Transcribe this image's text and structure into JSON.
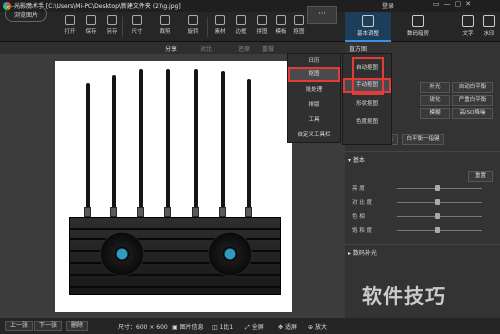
{
  "app": {
    "title": "光影魔术手  [C:\\Users\\Mi-PC\\Desktop\\新建文件夹 (2)\\g.jpg]",
    "user_login": "登录",
    "window_controls": [
      "▭",
      "—",
      "▢",
      "✕"
    ]
  },
  "toolbar": {
    "browse": "浏览图片",
    "tools": [
      {
        "label": "打开",
        "icon": "folder-icon"
      },
      {
        "label": "保存",
        "icon": "save-icon"
      },
      {
        "label": "另存",
        "icon": "save-as-icon"
      },
      {
        "label": "尺寸",
        "icon": "resize-icon"
      },
      {
        "label": "裁剪",
        "icon": "crop-icon"
      },
      {
        "label": "旋转",
        "icon": "rotate-icon"
      },
      {
        "label": "素材",
        "icon": "material-icon"
      },
      {
        "label": "边框",
        "icon": "frame-icon"
      },
      {
        "label": "拼图",
        "icon": "collage-icon"
      },
      {
        "label": "模板",
        "icon": "template-icon"
      },
      {
        "label": "抠图",
        "icon": "cutout-icon"
      }
    ],
    "more": "···"
  },
  "right_tabs": [
    {
      "label": "基本调整",
      "icon": "adjust-icon"
    },
    {
      "label": "数码暗房",
      "icon": "darkroom-icon"
    },
    {
      "label": "文字",
      "icon": "text-icon"
    },
    {
      "label": "水印",
      "icon": "watermark-icon"
    }
  ],
  "subbar": {
    "share": "分享",
    "compare": "对比",
    "undo": "还原",
    "redo": "重做"
  },
  "menu_main": [
    "日历",
    "抠图",
    "批处理",
    "排版",
    "工具",
    "自定义工具栏"
  ],
  "menu_sub": [
    "自动抠图",
    "手动抠图",
    "形状抠图",
    "色度抠图"
  ],
  "panel": {
    "header": "直方图",
    "right_buttons": [
      "补光",
      "自动白平衡",
      "锐化",
      "严重白平衡",
      "模糊",
      "高ISO降噪"
    ],
    "bottom_buttons": [
      "数字点测光",
      "白平衡一指键"
    ],
    "basic_title": "基本",
    "reset": "重置",
    "sliders": [
      {
        "label": "亮    度",
        "value": 0
      },
      {
        "label": "对 比 度",
        "value": 0
      },
      {
        "label": "色    相",
        "value": 0
      },
      {
        "label": "饱 和 度",
        "value": 0
      }
    ],
    "digital_title": "数码补光"
  },
  "statusbar": {
    "prev": "上一张",
    "next": "下一张",
    "delete": "删除",
    "size": "尺寸：600 × 600",
    "info": "图片信息",
    "fit": "1比1",
    "full": "全屏",
    "select": "适屏",
    "zoom": "放大"
  },
  "watermark": "软件技巧",
  "colors": {
    "accent": "#3d8fe0",
    "highlight_box": "#e23b3b"
  }
}
